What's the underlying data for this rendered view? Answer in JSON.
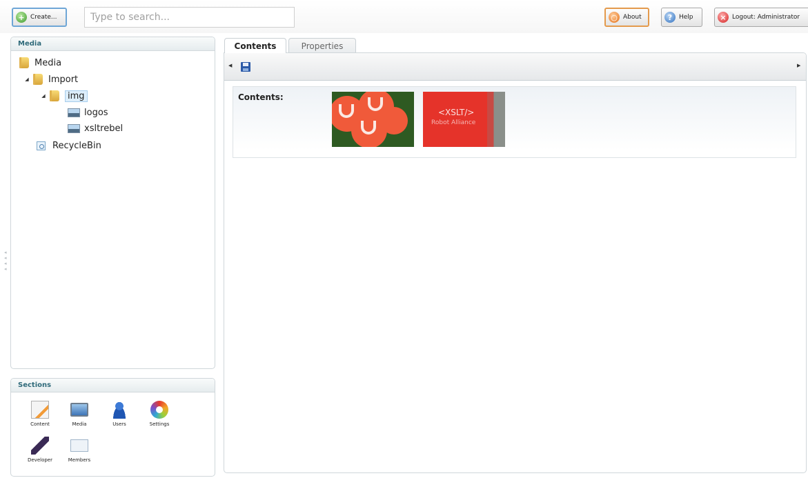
{
  "topbar": {
    "create_label": "Create...",
    "search_placeholder": "Type to search...",
    "about_label": "About",
    "help_label": "Help",
    "logout_label": "Logout: Administrator"
  },
  "tree_panel": {
    "title": "Media",
    "nodes": [
      {
        "label": "Media",
        "icon": "folder-icon"
      },
      {
        "label": "Import",
        "icon": "folder-icon",
        "expanded": true
      },
      {
        "label": "img",
        "icon": "folder-icon",
        "expanded": true,
        "selected": true
      },
      {
        "label": "logos",
        "icon": "image-icon"
      },
      {
        "label": "xsltrebel",
        "icon": "image-icon"
      },
      {
        "label": "RecycleBin",
        "icon": "recycle-bin-icon"
      }
    ]
  },
  "sections": {
    "title": "Sections",
    "items": [
      {
        "label": "Content",
        "icon": "content-icon"
      },
      {
        "label": "Media",
        "icon": "media-icon"
      },
      {
        "label": "Users",
        "icon": "users-icon"
      },
      {
        "label": "Settings",
        "icon": "settings-icon"
      },
      {
        "label": "Developer",
        "icon": "developer-icon"
      },
      {
        "label": "Members",
        "icon": "members-icon"
      }
    ]
  },
  "editor": {
    "tabs": [
      {
        "label": "Contents",
        "active": true
      },
      {
        "label": "Properties",
        "active": false
      }
    ],
    "contents_label": "Contents:",
    "thumbnails": [
      {
        "name": "logos",
        "shirt_line1": "",
        "shirt_line2": ""
      },
      {
        "name": "xsltrebel",
        "shirt_line1": "<XSLT/>",
        "shirt_line2": "Robot Alliance"
      }
    ]
  },
  "colors": {
    "accent_blue": "#6ea6d6",
    "accent_orange": "#e49a4c",
    "panel_heading": "#2f6a7a"
  }
}
